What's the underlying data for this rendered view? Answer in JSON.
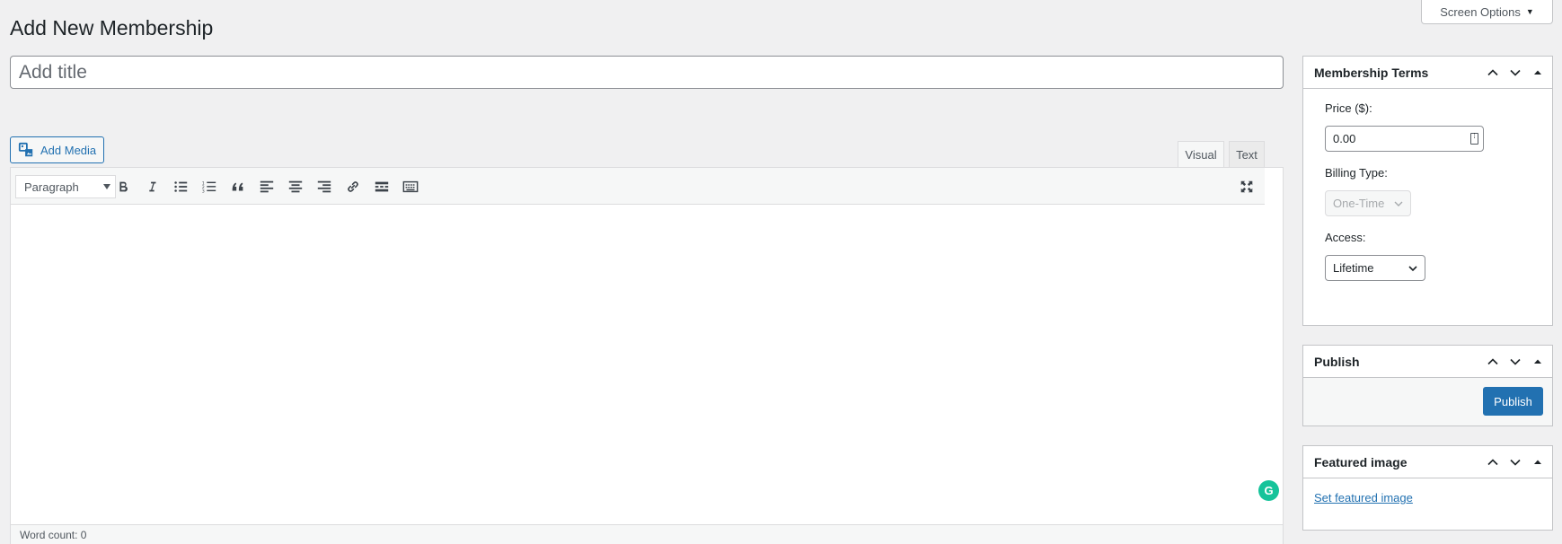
{
  "page": {
    "title": "Add New Membership"
  },
  "screen_options": {
    "label": "Screen Options"
  },
  "title_field": {
    "placeholder": "Add title",
    "value": ""
  },
  "editor": {
    "add_media_label": "Add Media",
    "tabs": [
      {
        "label": "Visual",
        "active": true
      },
      {
        "label": "Text",
        "active": false
      }
    ],
    "format_select": "Paragraph",
    "toolbar_icons": [
      "bold-icon",
      "italic-icon",
      "bulleted-list-icon",
      "numbered-list-icon",
      "blockquote-icon",
      "align-left-icon",
      "align-center-icon",
      "align-right-icon",
      "link-icon",
      "read-more-icon",
      "toolbar-toggle-icon",
      "fullscreen-icon"
    ],
    "word_count": "Word count: 0",
    "grammarly_glyph": "G"
  },
  "membership_terms": {
    "title": "Membership Terms",
    "price_label": "Price ($):",
    "price_value": "0.00",
    "billing_label": "Billing Type:",
    "billing_value": "One-Time",
    "access_label": "Access:",
    "access_value": "Lifetime"
  },
  "publish_box": {
    "title": "Publish",
    "button": "Publish"
  },
  "featured_box": {
    "title": "Featured image",
    "link": "Set featured image"
  },
  "colors": {
    "accent": "#2271b1",
    "background": "#f0f0f1",
    "grammarly": "#15c39a"
  }
}
